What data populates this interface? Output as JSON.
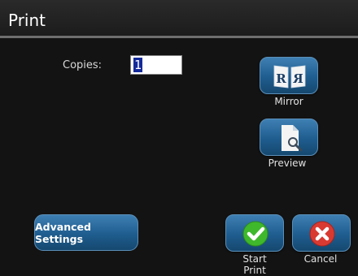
{
  "window": {
    "title": "Print"
  },
  "copies": {
    "label": "Copies:",
    "value": "1"
  },
  "buttons": {
    "mirror": "Mirror",
    "preview": "Preview",
    "advanced_settings": "Advanced Settings",
    "start_print": "Start\nPrint",
    "start_print_line1": "Start",
    "start_print_line2": "Print",
    "cancel": "Cancel"
  },
  "icons": {
    "mirror": "mirror-icon",
    "preview": "preview-icon",
    "start_print": "checkmark-icon",
    "cancel": "cancel-x-icon"
  },
  "colors": {
    "button_blue": "#1f5d8f",
    "check_green": "#3fb82c",
    "cancel_red": "#d83a32",
    "selection": "#142a9a"
  }
}
